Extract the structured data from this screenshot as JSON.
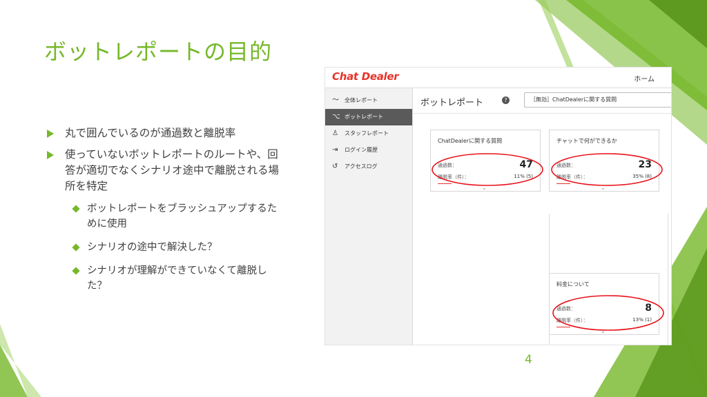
{
  "slide": {
    "title": "ボットレポートの目的",
    "bullets": [
      {
        "text": "丸で囲んでいるのが通過数と離脱率"
      },
      {
        "text": "使っていないボットレポートのルートや、回答が適切でなくシナリオ途中で離脱される場所を特定"
      }
    ],
    "sub_bullets": [
      {
        "text": "ボットレポートをブラッシュアップするために使用"
      },
      {
        "text": "シナリオの途中で解決した？"
      },
      {
        "text": "シナリオが理解ができていなくて離脱した？"
      }
    ],
    "page_number": "4",
    "accent_color": "#76b82a"
  },
  "app": {
    "logo": "Chat Dealer",
    "home_link": "ホーム",
    "nav": [
      {
        "icon": "trend-line-icon",
        "label": "全体レポート"
      },
      {
        "icon": "bot-icon",
        "label": "ボットレポート"
      },
      {
        "icon": "person-icon",
        "label": "スタッフレポート"
      },
      {
        "icon": "login-icon",
        "label": "ログイン履歴"
      },
      {
        "icon": "history-icon",
        "label": "アクセスログ"
      }
    ],
    "page_title": "ボットレポート",
    "help_symbol": "?",
    "scenario_select": "［無効］ChatDealerに関する質問",
    "cards": [
      {
        "title": "ChatDealerに関する質問",
        "pass_label": "通過数：",
        "pass_value": "47",
        "exit_label": "離脱率（件）：",
        "exit_value": "11% (5)"
      },
      {
        "title": "チャットで何ができるか",
        "pass_label": "通過数：",
        "pass_value": "23",
        "exit_label": "離脱率（件）：",
        "exit_value": "35% (8)"
      },
      {
        "title": "料金について",
        "pass_label": "通過数：",
        "pass_value": "8",
        "exit_label": "離脱率（件）：",
        "exit_value": "13% (1)"
      }
    ],
    "annotation_color": "#e8111a",
    "brand_color": "#e63329"
  }
}
